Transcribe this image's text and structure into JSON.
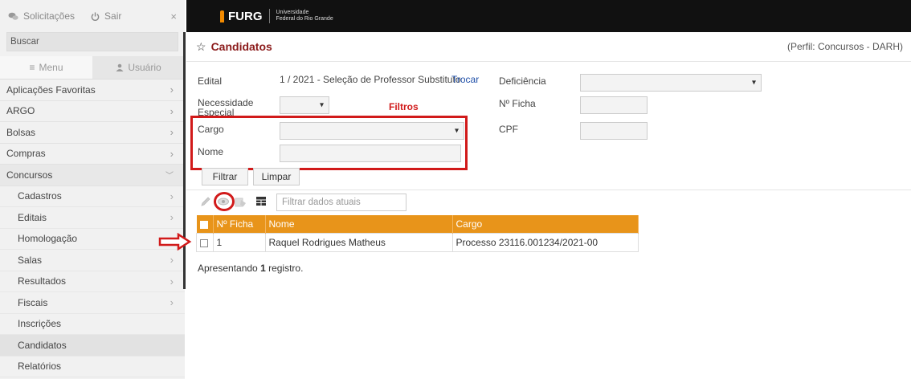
{
  "sidebar": {
    "top": {
      "requests_label": "Solicitações",
      "logout_label": "Sair",
      "close_symbol": "×"
    },
    "search_label": "Buscar",
    "tabs": {
      "menu_label": "Menu",
      "user_label": "Usuário"
    },
    "menu_items": [
      {
        "label": "Aplicações Favoritas"
      },
      {
        "label": "ARGO"
      },
      {
        "label": "Bolsas"
      },
      {
        "label": "Compras"
      },
      {
        "label": "Concursos"
      }
    ],
    "sub_items": [
      {
        "label": "Cadastros"
      },
      {
        "label": "Editais"
      },
      {
        "label": "Homologação"
      },
      {
        "label": "Salas"
      },
      {
        "label": "Resultados"
      },
      {
        "label": "Fiscais"
      },
      {
        "label": "Inscrições"
      },
      {
        "label": "Candidatos"
      },
      {
        "label": "Relatórios"
      }
    ]
  },
  "header": {
    "logo_text": "FURG",
    "university_line1": "Universidade",
    "university_line2": "Federal do Rio Grande"
  },
  "page": {
    "title": "Candidatos",
    "profile": "(Perfil: Concursos - DARH)"
  },
  "form": {
    "edital_label": "Edital",
    "edital_value": "1 / 2021 - Seleção de Professor Substituto",
    "trocar_label": "Trocar",
    "necessidade_label_1": "Necessidade",
    "necessidade_label_2": "Especial",
    "cargo_label": "Cargo",
    "nome_label": "Nome",
    "deficiencia_label": "Deficiência",
    "nficha_label": "Nº Ficha",
    "cpf_label": "CPF",
    "filtrar_label": "Filtrar",
    "limpar_label": "Limpar",
    "annotation_filtros": "Filtros"
  },
  "toolbar": {
    "filter_placeholder": "Filtrar dados atuais"
  },
  "table": {
    "headers": {
      "nficha": "Nº Ficha",
      "nome": "Nome",
      "cargo": "Cargo"
    },
    "rows": [
      {
        "nficha": "1",
        "nome": "Raquel Rodrigues Matheus",
        "cargo": "Processo 23116.001234/2021-00"
      }
    ]
  },
  "footer": {
    "count_prefix": "Apresentando ",
    "count_value": "1",
    "count_suffix": " registro."
  },
  "colors": {
    "title": "#8b1a1a",
    "table_header": "#e8941a",
    "annotation": "#d11a1a",
    "link": "#1f4fa8"
  }
}
